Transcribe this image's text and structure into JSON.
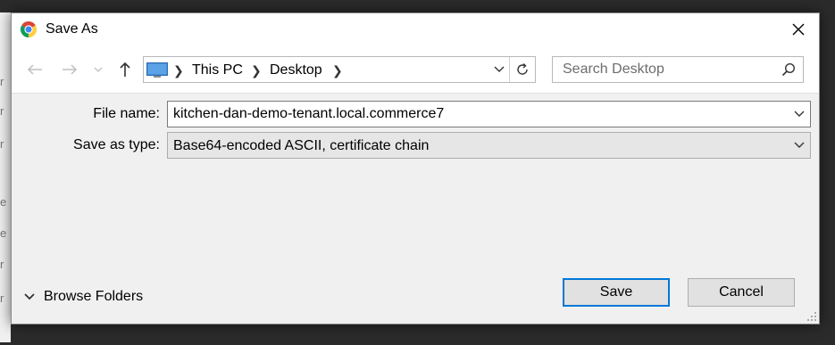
{
  "window": {
    "title": "Save As",
    "app_icon": "chrome-icon",
    "close_icon": "close-icon"
  },
  "background": {
    "glyphs": [
      "r",
      "r",
      "r",
      "e",
      "e",
      "r",
      "r"
    ]
  },
  "navigation": {
    "back_icon": "arrow-left-icon",
    "forward_icon": "arrow-right-icon",
    "recent_icon": "chevron-down-icon",
    "up_icon": "arrow-up-icon",
    "breadcrumb": [
      {
        "label": "This PC"
      },
      {
        "label": "Desktop"
      }
    ],
    "refresh_icon": "refresh-icon"
  },
  "search": {
    "placeholder": "Search Desktop",
    "icon": "search-icon"
  },
  "form": {
    "file_name_label": "File name:",
    "file_name_value": "kitchen-dan-demo-tenant.local.commerce7",
    "save_type_label": "Save as type:",
    "save_type_value": "Base64-encoded ASCII, certificate chain"
  },
  "footer": {
    "browse_label": "Browse Folders",
    "save_label": "Save",
    "cancel_label": "Cancel"
  },
  "colors": {
    "accent": "#0078d7",
    "dialog_bg": "#f0f0f0",
    "outer_bg": "#2b2b2b"
  }
}
